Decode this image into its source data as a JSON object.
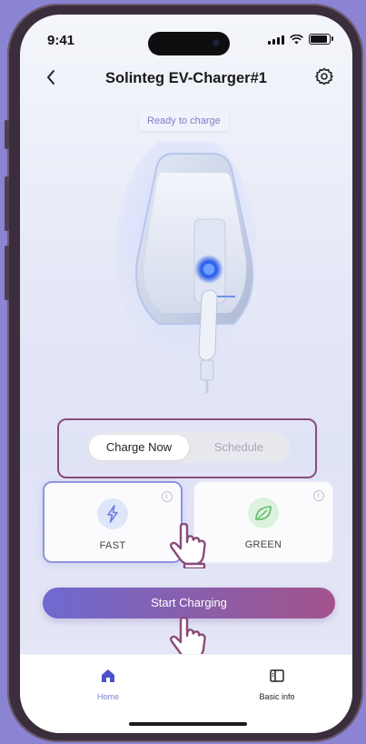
{
  "status_bar": {
    "time": "9:41"
  },
  "header": {
    "title": "Solinteg EV-Charger#1"
  },
  "charger": {
    "status_chip": "Ready to charge"
  },
  "mode_toggle": {
    "active": "Charge Now",
    "inactive": "Schedule"
  },
  "cards": {
    "fast": {
      "label": "FAST"
    },
    "green": {
      "label": "GREEN"
    }
  },
  "actions": {
    "start_label": "Start Charging"
  },
  "bottom_nav": {
    "home_label": "Home",
    "basic_label": "Basic info"
  },
  "colors": {
    "accent": "#7c80cf",
    "button_start": "#6e6ad0",
    "button_end": "#a3538b",
    "highlight": "#8a4c7a",
    "background": "#8a84d3"
  },
  "icons": [
    "back-icon",
    "gear-icon",
    "lightning-icon",
    "leaf-icon",
    "info-icon",
    "home-icon",
    "book-icon",
    "pointer-hand-icon"
  ]
}
